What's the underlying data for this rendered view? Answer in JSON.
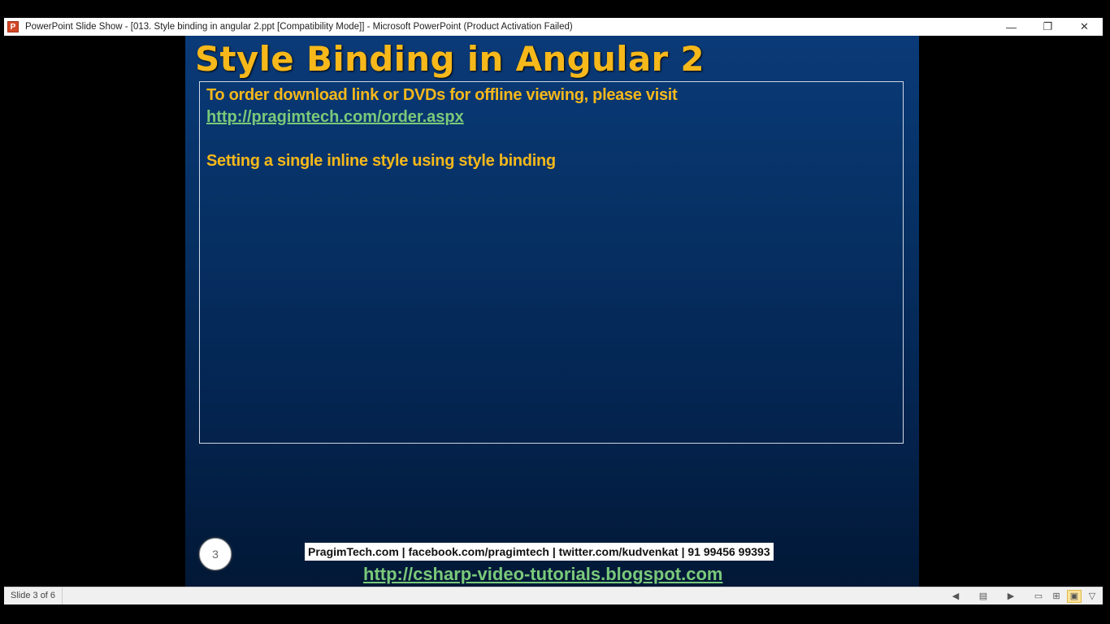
{
  "window": {
    "app_icon_letter": "P",
    "title": "PowerPoint Slide Show - [013. Style binding in angular 2.ppt [Compatibility Mode]] - Microsoft PowerPoint (Product Activation Failed)",
    "controls": {
      "minimize": "—",
      "restore": "❐",
      "close": "✕"
    }
  },
  "slide": {
    "title": "Style Binding in Angular 2",
    "line1": "To order download link or DVDs for offline viewing, please visit",
    "link1": "http://pragimtech.com/order.aspx",
    "line2": "Setting a single inline style using style binding",
    "number": "3",
    "footer_text": "PragimTech.com | facebook.com/pragimtech  | twitter.com/kudvenkat  | 91 99456 99393",
    "footer_link": "http://csharp-video-tutorials.blogspot.com"
  },
  "statusbar": {
    "slide_position": "Slide 3 of 6",
    "icons": {
      "prev": "◀",
      "menu": "▤",
      "next": "▶",
      "normal": "▭",
      "sorter": "⊞",
      "reading": "▣",
      "slideshow": "▽"
    }
  }
}
